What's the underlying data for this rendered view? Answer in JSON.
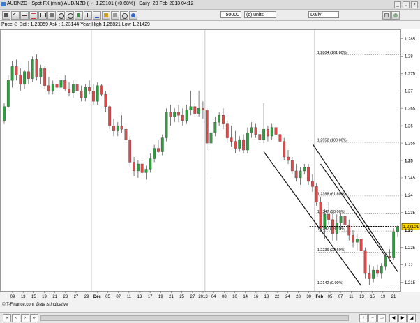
{
  "window": {
    "title": "AUDNZD - Spot FX (mini) AUD/NZD (-)   1.23101 (+0.68%)   Daily  20 Feb 2013 04:12"
  },
  "toolbar": {
    "quantity_value": "50000",
    "units_label": "(c) units",
    "period_value": "Daily"
  },
  "info": {
    "text": "Price ⊙ Bid : 1.23059 Ask : 1.23144 Year:High 1.26821 Low 1.21429"
  },
  "footer": {
    "source": "©IT-Finance.com",
    "note": "Data is indicative"
  },
  "chart_data": {
    "type": "candlestick",
    "instrument": "AUDNZD",
    "period": "Daily",
    "last_price": 1.23101,
    "change_percent": 0.68,
    "bid": 1.23059,
    "ask": 1.23144,
    "year_high": 1.26821,
    "year_low": 1.21429,
    "y_range": [
      1.2125,
      1.2875
    ],
    "y_ticks": [
      1.215,
      1.22,
      1.225,
      1.23,
      1.235,
      1.24,
      1.245,
      1.25,
      1.255,
      1.26,
      1.265,
      1.27,
      1.275,
      1.28,
      1.285
    ],
    "y_tick_labels": [
      "1.215",
      "1.22",
      "1.225",
      "1.23",
      "1.235",
      "1.24",
      "1.245",
      "1.25",
      "1.255",
      "1.26",
      "1.265",
      "1.27",
      "1.275",
      "1.28",
      "1.285"
    ],
    "x_labels": [
      "09",
      "13",
      "15",
      "19",
      "21",
      "23",
      "27",
      "29",
      "Dec",
      "05",
      "07",
      "11",
      "13",
      "17",
      "19",
      "21",
      "25",
      "27",
      "2013",
      "04",
      "08",
      "10",
      "14",
      "16",
      "18",
      "22",
      "24",
      "28",
      "30",
      "Feb",
      "05",
      "07",
      "11",
      "13",
      "15",
      "19",
      "21"
    ],
    "bar_count": 98,
    "vertical_separators_at_bar": [
      22,
      50,
      77
    ],
    "bull_color": "#2e9e3e",
    "bear_color": "#d94c4c",
    "fib_levels": [
      {
        "label": "1.2804 (161.80%)",
        "price": 1.2804
      },
      {
        "label": "1.2552 (100.00%)",
        "price": 1.2552
      },
      {
        "label": "1.2398 (61.80%)",
        "price": 1.2398
      },
      {
        "label": "1.2347 (50.00%)",
        "price": 1.2347
      },
      {
        "label": "1.2297 (38.20%)",
        "price": 1.2297
      },
      {
        "label": "1.2236 (23.60%)",
        "price": 1.2236
      },
      {
        "label": "1.2142 (0.00%)",
        "price": 1.2142
      }
    ],
    "current_price_label": "1.23101",
    "channel_lines": [
      {
        "x1": 64,
        "y1": 1.2525,
        "x2": 88,
        "y2": 1.214
      },
      {
        "x1": 76,
        "y1": 1.2548,
        "x2": 97,
        "y2": 1.218
      },
      {
        "x1": 78,
        "y1": 1.249,
        "x2": 94,
        "y2": 1.2225
      }
    ],
    "candles": [
      {
        "o": 1.2615,
        "h": 1.2665,
        "l": 1.2605,
        "c": 1.2655
      },
      {
        "o": 1.2655,
        "h": 1.2745,
        "l": 1.265,
        "c": 1.273
      },
      {
        "o": 1.273,
        "h": 1.2785,
        "l": 1.271,
        "c": 1.277
      },
      {
        "o": 1.277,
        "h": 1.279,
        "l": 1.273,
        "c": 1.2745
      },
      {
        "o": 1.2745,
        "h": 1.2765,
        "l": 1.27,
        "c": 1.272
      },
      {
        "o": 1.272,
        "h": 1.276,
        "l": 1.2705,
        "c": 1.2755
      },
      {
        "o": 1.2755,
        "h": 1.2785,
        "l": 1.272,
        "c": 1.2735
      },
      {
        "o": 1.2735,
        "h": 1.28,
        "l": 1.2725,
        "c": 1.279
      },
      {
        "o": 1.279,
        "h": 1.2805,
        "l": 1.273,
        "c": 1.274
      },
      {
        "o": 1.274,
        "h": 1.2775,
        "l": 1.272,
        "c": 1.2765
      },
      {
        "o": 1.2765,
        "h": 1.277,
        "l": 1.2705,
        "c": 1.2715
      },
      {
        "o": 1.2715,
        "h": 1.274,
        "l": 1.269,
        "c": 1.27
      },
      {
        "o": 1.27,
        "h": 1.273,
        "l": 1.269,
        "c": 1.272
      },
      {
        "o": 1.272,
        "h": 1.274,
        "l": 1.27,
        "c": 1.271
      },
      {
        "o": 1.271,
        "h": 1.274,
        "l": 1.2695,
        "c": 1.273
      },
      {
        "o": 1.273,
        "h": 1.2745,
        "l": 1.27,
        "c": 1.2705
      },
      {
        "o": 1.2705,
        "h": 1.2725,
        "l": 1.2685,
        "c": 1.2695
      },
      {
        "o": 1.2695,
        "h": 1.273,
        "l": 1.268,
        "c": 1.272
      },
      {
        "o": 1.272,
        "h": 1.273,
        "l": 1.269,
        "c": 1.27
      },
      {
        "o": 1.27,
        "h": 1.2715,
        "l": 1.267,
        "c": 1.268
      },
      {
        "o": 1.268,
        "h": 1.272,
        "l": 1.267,
        "c": 1.271
      },
      {
        "o": 1.271,
        "h": 1.273,
        "l": 1.269,
        "c": 1.27
      },
      {
        "o": 1.27,
        "h": 1.272,
        "l": 1.266,
        "c": 1.267
      },
      {
        "o": 1.267,
        "h": 1.2725,
        "l": 1.266,
        "c": 1.2715
      },
      {
        "o": 1.2715,
        "h": 1.272,
        "l": 1.2685,
        "c": 1.269
      },
      {
        "o": 1.269,
        "h": 1.27,
        "l": 1.264,
        "c": 1.2655
      },
      {
        "o": 1.2655,
        "h": 1.266,
        "l": 1.259,
        "c": 1.26
      },
      {
        "o": 1.26,
        "h": 1.262,
        "l": 1.257,
        "c": 1.2585
      },
      {
        "o": 1.2585,
        "h": 1.261,
        "l": 1.257,
        "c": 1.26
      },
      {
        "o": 1.26,
        "h": 1.263,
        "l": 1.258,
        "c": 1.259
      },
      {
        "o": 1.259,
        "h": 1.2605,
        "l": 1.255,
        "c": 1.256
      },
      {
        "o": 1.256,
        "h": 1.257,
        "l": 1.248,
        "c": 1.2495
      },
      {
        "o": 1.2495,
        "h": 1.251,
        "l": 1.2455,
        "c": 1.247
      },
      {
        "o": 1.247,
        "h": 1.25,
        "l": 1.245,
        "c": 1.249
      },
      {
        "o": 1.249,
        "h": 1.25,
        "l": 1.2455,
        "c": 1.2465
      },
      {
        "o": 1.2465,
        "h": 1.2485,
        "l": 1.2445,
        "c": 1.2475
      },
      {
        "o": 1.2475,
        "h": 1.252,
        "l": 1.2465,
        "c": 1.2505
      },
      {
        "o": 1.2505,
        "h": 1.2545,
        "l": 1.2495,
        "c": 1.2535
      },
      {
        "o": 1.2535,
        "h": 1.256,
        "l": 1.252,
        "c": 1.2525
      },
      {
        "o": 1.2525,
        "h": 1.2575,
        "l": 1.2515,
        "c": 1.2565
      },
      {
        "o": 1.2565,
        "h": 1.265,
        "l": 1.2555,
        "c": 1.264
      },
      {
        "o": 1.264,
        "h": 1.266,
        "l": 1.26,
        "c": 1.2625
      },
      {
        "o": 1.2625,
        "h": 1.265,
        "l": 1.261,
        "c": 1.264
      },
      {
        "o": 1.264,
        "h": 1.266,
        "l": 1.261,
        "c": 1.263
      },
      {
        "o": 1.263,
        "h": 1.265,
        "l": 1.26,
        "c": 1.2615
      },
      {
        "o": 1.2615,
        "h": 1.266,
        "l": 1.2605,
        "c": 1.2645
      },
      {
        "o": 1.2645,
        "h": 1.27,
        "l": 1.263,
        "c": 1.2655
      },
      {
        "o": 1.2655,
        "h": 1.2665,
        "l": 1.2625,
        "c": 1.2635
      },
      {
        "o": 1.2635,
        "h": 1.27,
        "l": 1.2625,
        "c": 1.265
      },
      {
        "o": 1.265,
        "h": 1.267,
        "l": 1.262,
        "c": 1.2645
      },
      {
        "o": 1.2645,
        "h": 1.265,
        "l": 1.253,
        "c": 1.255
      },
      {
        "o": 1.255,
        "h": 1.26,
        "l": 1.246,
        "c": 1.258
      },
      {
        "o": 1.258,
        "h": 1.2625,
        "l": 1.257,
        "c": 1.261
      },
      {
        "o": 1.261,
        "h": 1.264,
        "l": 1.26,
        "c": 1.263
      },
      {
        "o": 1.263,
        "h": 1.265,
        "l": 1.259,
        "c": 1.2605
      },
      {
        "o": 1.2605,
        "h": 1.2615,
        "l": 1.255,
        "c": 1.2565
      },
      {
        "o": 1.2565,
        "h": 1.26,
        "l": 1.254,
        "c": 1.2555
      },
      {
        "o": 1.2555,
        "h": 1.2585,
        "l": 1.252,
        "c": 1.2535
      },
      {
        "o": 1.2535,
        "h": 1.257,
        "l": 1.2525,
        "c": 1.256
      },
      {
        "o": 1.256,
        "h": 1.2575,
        "l": 1.252,
        "c": 1.253
      },
      {
        "o": 1.253,
        "h": 1.2595,
        "l": 1.252,
        "c": 1.258
      },
      {
        "o": 1.258,
        "h": 1.261,
        "l": 1.2565,
        "c": 1.2595
      },
      {
        "o": 1.2595,
        "h": 1.2605,
        "l": 1.2565,
        "c": 1.2575
      },
      {
        "o": 1.2575,
        "h": 1.259,
        "l": 1.255,
        "c": 1.256
      },
      {
        "o": 1.256,
        "h": 1.2665,
        "l": 1.255,
        "c": 1.259
      },
      {
        "o": 1.259,
        "h": 1.26,
        "l": 1.2555,
        "c": 1.257
      },
      {
        "o": 1.257,
        "h": 1.2605,
        "l": 1.256,
        "c": 1.2595
      },
      {
        "o": 1.2595,
        "h": 1.2605,
        "l": 1.256,
        "c": 1.2575
      },
      {
        "o": 1.2575,
        "h": 1.2585,
        "l": 1.2545,
        "c": 1.2555
      },
      {
        "o": 1.2555,
        "h": 1.2565,
        "l": 1.25,
        "c": 1.251
      },
      {
        "o": 1.251,
        "h": 1.253,
        "l": 1.249,
        "c": 1.25
      },
      {
        "o": 1.25,
        "h": 1.251,
        "l": 1.246,
        "c": 1.247
      },
      {
        "o": 1.247,
        "h": 1.249,
        "l": 1.244,
        "c": 1.245
      },
      {
        "o": 1.245,
        "h": 1.248,
        "l": 1.243,
        "c": 1.247
      },
      {
        "o": 1.247,
        "h": 1.249,
        "l": 1.246,
        "c": 1.248
      },
      {
        "o": 1.248,
        "h": 1.249,
        "l": 1.243,
        "c": 1.244
      },
      {
        "o": 1.244,
        "h": 1.246,
        "l": 1.241,
        "c": 1.2425
      },
      {
        "o": 1.2425,
        "h": 1.2435,
        "l": 1.237,
        "c": 1.238
      },
      {
        "o": 1.238,
        "h": 1.2395,
        "l": 1.2295,
        "c": 1.2305
      },
      {
        "o": 1.2305,
        "h": 1.236,
        "l": 1.2275,
        "c": 1.2345
      },
      {
        "o": 1.2345,
        "h": 1.238,
        "l": 1.2315,
        "c": 1.233
      },
      {
        "o": 1.233,
        "h": 1.2355,
        "l": 1.227,
        "c": 1.229
      },
      {
        "o": 1.229,
        "h": 1.2345,
        "l": 1.227,
        "c": 1.232
      },
      {
        "o": 1.232,
        "h": 1.235,
        "l": 1.23,
        "c": 1.234
      },
      {
        "o": 1.234,
        "h": 1.2355,
        "l": 1.2305,
        "c": 1.2315
      },
      {
        "o": 1.2315,
        "h": 1.233,
        "l": 1.227,
        "c": 1.2285
      },
      {
        "o": 1.2285,
        "h": 1.23,
        "l": 1.225,
        "c": 1.2265
      },
      {
        "o": 1.2265,
        "h": 1.229,
        "l": 1.224,
        "c": 1.2275
      },
      {
        "o": 1.2275,
        "h": 1.2285,
        "l": 1.223,
        "c": 1.224
      },
      {
        "o": 1.224,
        "h": 1.225,
        "l": 1.216,
        "c": 1.2175
      },
      {
        "o": 1.2175,
        "h": 1.22,
        "l": 1.2143,
        "c": 1.216
      },
      {
        "o": 1.216,
        "h": 1.2195,
        "l": 1.215,
        "c": 1.2185
      },
      {
        "o": 1.2185,
        "h": 1.22,
        "l": 1.2165,
        "c": 1.2175
      },
      {
        "o": 1.2175,
        "h": 1.2205,
        "l": 1.216,
        "c": 1.2195
      },
      {
        "o": 1.2195,
        "h": 1.2235,
        "l": 1.2185,
        "c": 1.2225
      },
      {
        "o": 1.2225,
        "h": 1.2245,
        "l": 1.221,
        "c": 1.222
      },
      {
        "o": 1.222,
        "h": 1.2305,
        "l": 1.2215,
        "c": 1.2295
      },
      {
        "o": 1.2295,
        "h": 1.2315,
        "l": 1.228,
        "c": 1.231
      }
    ]
  }
}
